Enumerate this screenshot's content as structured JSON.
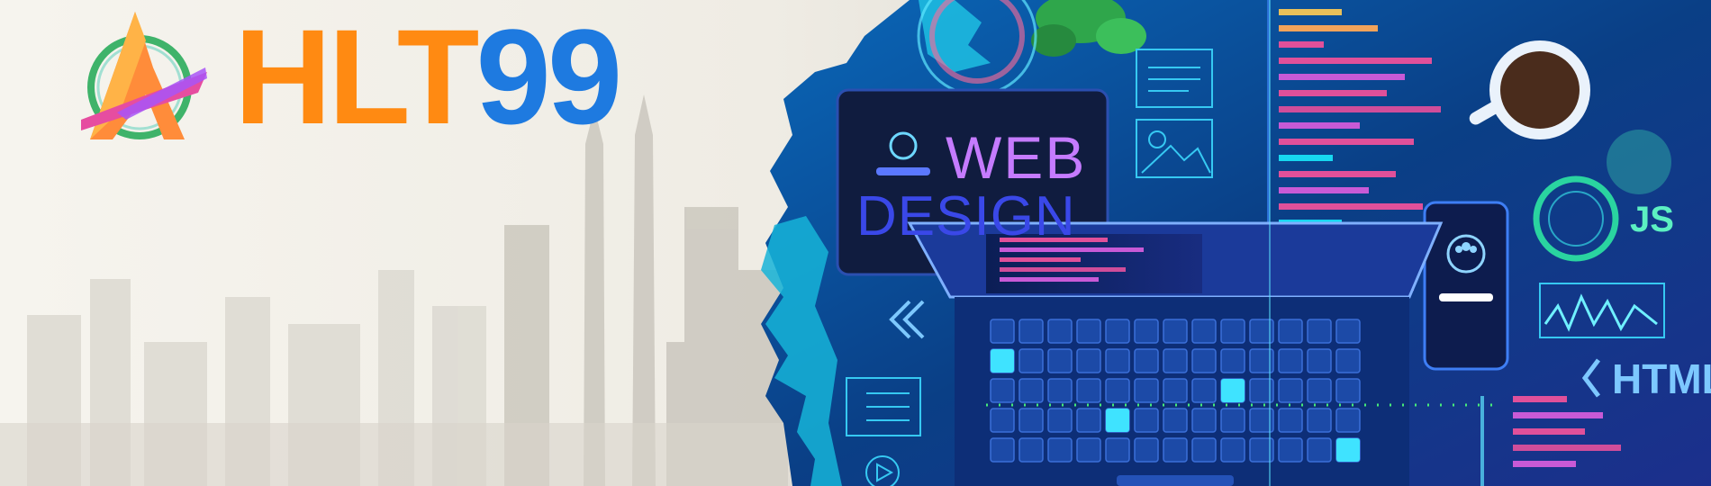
{
  "brand": {
    "name_part1": "HLT",
    "name_part2": "99",
    "logo": "triangle-a-logo"
  },
  "hero": {
    "tablet_line1": "WEB",
    "tablet_line2": "DESIGN",
    "tag_js": "JS",
    "tag_html": "HTML"
  },
  "colors": {
    "brand_orange": "#ff8a12",
    "brand_blue": "#1e7ae0",
    "tech_bg": "#0b3e8a",
    "accent_cyan": "#17d8f0",
    "accent_pink": "#e0509a"
  },
  "icons": [
    "triangle-a-logo",
    "coffee-cup-icon",
    "plant-icon",
    "user-group-icon",
    "image-icon",
    "checklist-icon",
    "play-icon",
    "chevron-left-icon",
    "waveform-icon"
  ]
}
